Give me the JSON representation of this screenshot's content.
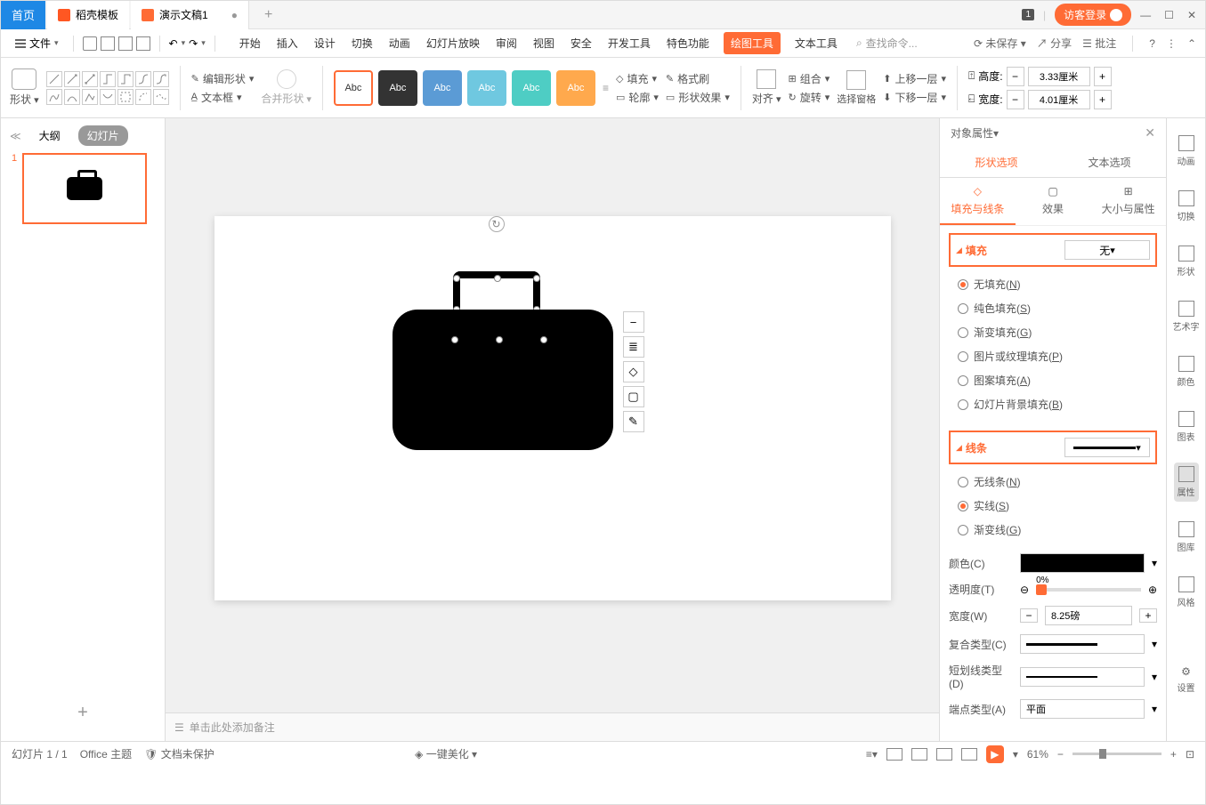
{
  "titlebar": {
    "home": "首页",
    "daoke": "稻壳模板",
    "doc": "演示文稿1",
    "badge": "1",
    "login": "访客登录"
  },
  "menu": {
    "file": "文件",
    "tabs": [
      "开始",
      "插入",
      "设计",
      "切换",
      "动画",
      "幻灯片放映",
      "审阅",
      "视图",
      "安全",
      "开发工具",
      "特色功能",
      "绘图工具",
      "文本工具"
    ],
    "search": "查找命令...",
    "unsaved": "未保存",
    "share": "分享",
    "comment": "批注"
  },
  "ribbon": {
    "shape": "形状",
    "edit_shape": "编辑形状",
    "textbox": "文本框",
    "merge": "合并形状",
    "abc": "Abc",
    "fill": "填充",
    "brush": "格式刷",
    "outline": "轮廓",
    "effect": "形状效果",
    "align": "对齐",
    "group": "组合",
    "rotate": "旋转",
    "select_pane": "选择窗格",
    "up": "上移一层",
    "down": "下移一层",
    "height": "高度:",
    "width": "宽度:",
    "height_val": "3.33厘米",
    "width_val": "4.01厘米"
  },
  "left": {
    "outline": "大纲",
    "slides": "幻灯片",
    "num": "1"
  },
  "notes": "单击此处添加备注",
  "right": {
    "title": "对象属性",
    "tab_shape": "形状选项",
    "tab_text": "文本选项",
    "sub_fill": "填充与线条",
    "sub_effect": "效果",
    "sub_size": "大小与属性",
    "fill": {
      "title": "填充",
      "sel": "无",
      "opts": [
        "无填充(N)",
        "纯色填充(S)",
        "渐变填充(G)",
        "图片或纹理填充(P)",
        "图案填充(A)",
        "幻灯片背景填充(B)"
      ]
    },
    "line": {
      "title": "线条",
      "opts": [
        "无线条(N)",
        "实线(S)",
        "渐变线(G)"
      ]
    },
    "color": "颜色(C)",
    "trans": "透明度(T)",
    "trans_val": "0%",
    "width": "宽度(W)",
    "width_val": "8.25磅",
    "compound": "复合类型(C)",
    "dash": "短划线类型(D)",
    "cap": "端点类型(A)",
    "cap_val": "平面"
  },
  "side": [
    "动画",
    "切换",
    "形状",
    "艺术字",
    "颜色",
    "图表",
    "属性",
    "图库",
    "风格",
    "设置"
  ],
  "status": {
    "slide": "幻灯片 1 / 1",
    "theme": "Office 主题",
    "protect": "文档未保护",
    "beautify": "一键美化",
    "zoom": "61%"
  }
}
